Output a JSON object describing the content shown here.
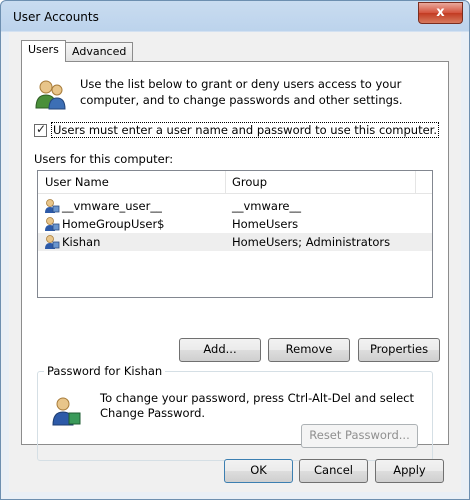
{
  "window": {
    "title": "User Accounts",
    "close_glyph": "x"
  },
  "tabs": [
    {
      "label": "Users"
    },
    {
      "label": "Advanced"
    }
  ],
  "intro_text": "Use the list below to grant or deny users access to your computer, and to change passwords and other settings.",
  "require_login_checkbox": {
    "label": "Users must enter a user name and password to use this computer.",
    "checked": true,
    "mark": "✓"
  },
  "users_label": "Users for this computer:",
  "users_table": {
    "columns": [
      "User Name",
      "Group"
    ],
    "rows": [
      {
        "name": "__vmware_user__",
        "group": "__vmware__"
      },
      {
        "name": "HomeGroupUser$",
        "group": "HomeUsers"
      },
      {
        "name": "Kishan",
        "group": "HomeUsers; Administrators"
      }
    ],
    "selected_row": "Kishan"
  },
  "buttons": {
    "add": "Add...",
    "remove": "Remove",
    "properties": "Properties"
  },
  "password_group": {
    "title": "Password for Kishan",
    "text": "To change your password, press Ctrl-Alt-Del and select Change Password.",
    "reset_button": "Reset Password..."
  },
  "footer": {
    "ok": "OK",
    "cancel": "Cancel",
    "apply": "Apply"
  },
  "icons": {
    "users": "users-icon",
    "user_row": "user-icon",
    "password": "user-key-icon"
  }
}
